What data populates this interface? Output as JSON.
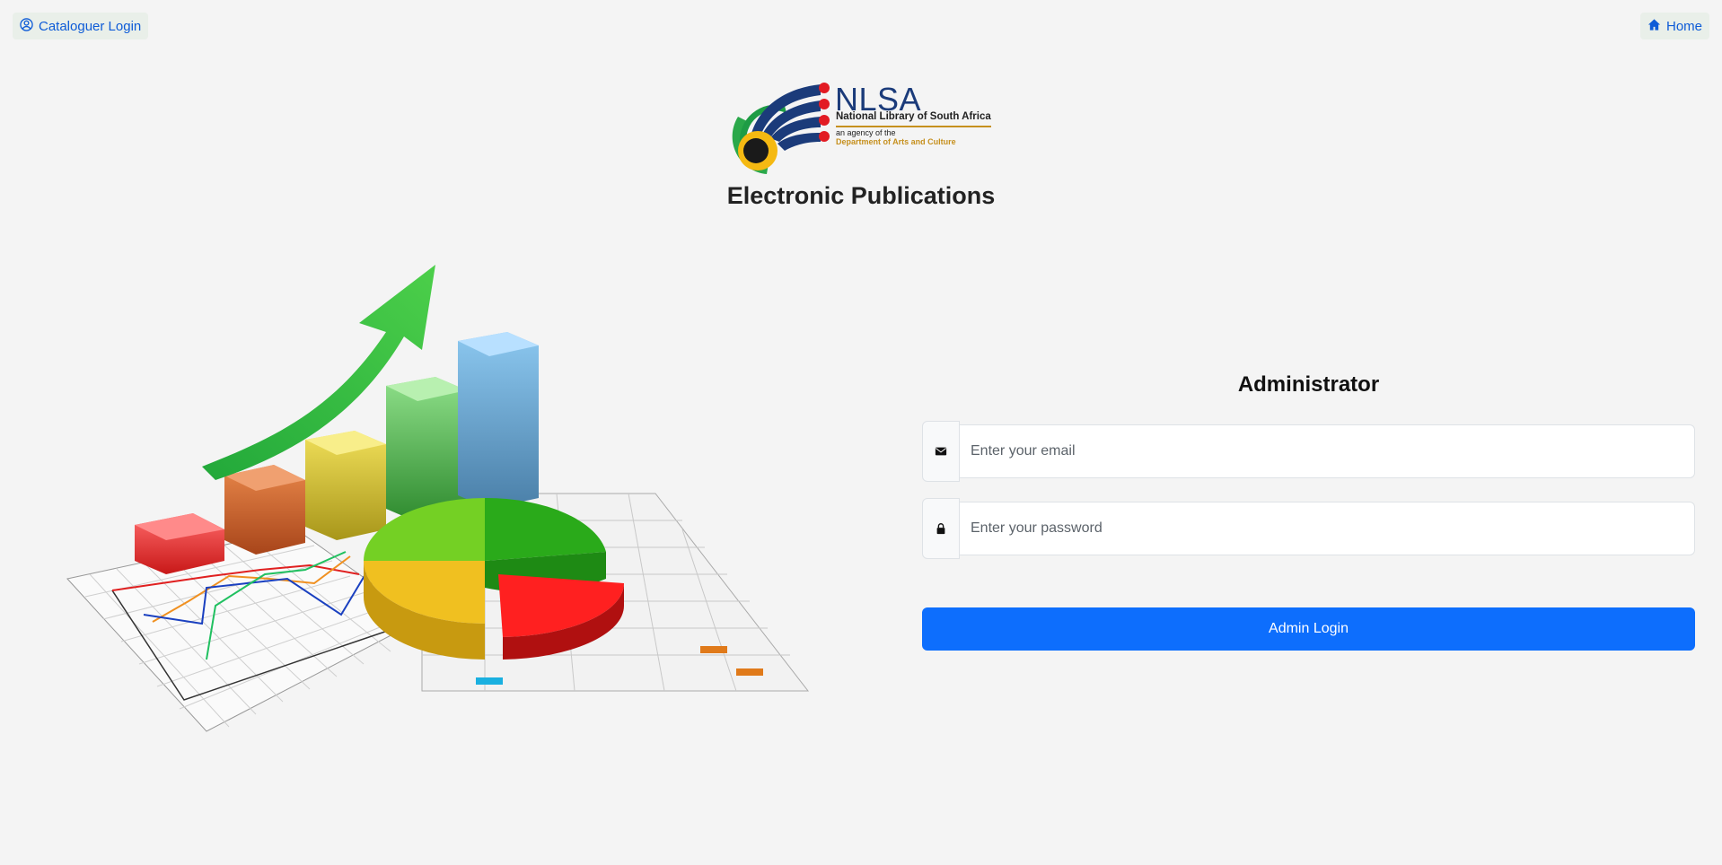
{
  "nav": {
    "cataloguer_login_label": "Cataloguer Login",
    "home_label": "Home"
  },
  "logo": {
    "abbreviation": "NLSA",
    "full_name": "National Library of South Africa",
    "agency_line": "an agency of the",
    "department": "Department of Arts and Culture"
  },
  "page_title": "Electronic Publications",
  "login": {
    "title": "Administrator",
    "email_placeholder": "Enter your email",
    "password_placeholder": "Enter your password",
    "submit_label": "Admin Login"
  },
  "icons": {
    "cataloguer": "user-circle-icon",
    "home": "home-icon",
    "email": "envelope-icon",
    "password": "lock-icon"
  },
  "colors": {
    "primary": "#0d6efd",
    "link": "#0d5bd7",
    "background": "#f4f4f4",
    "logo_blue": "#1b3b7a",
    "logo_gold": "#c6901e"
  }
}
